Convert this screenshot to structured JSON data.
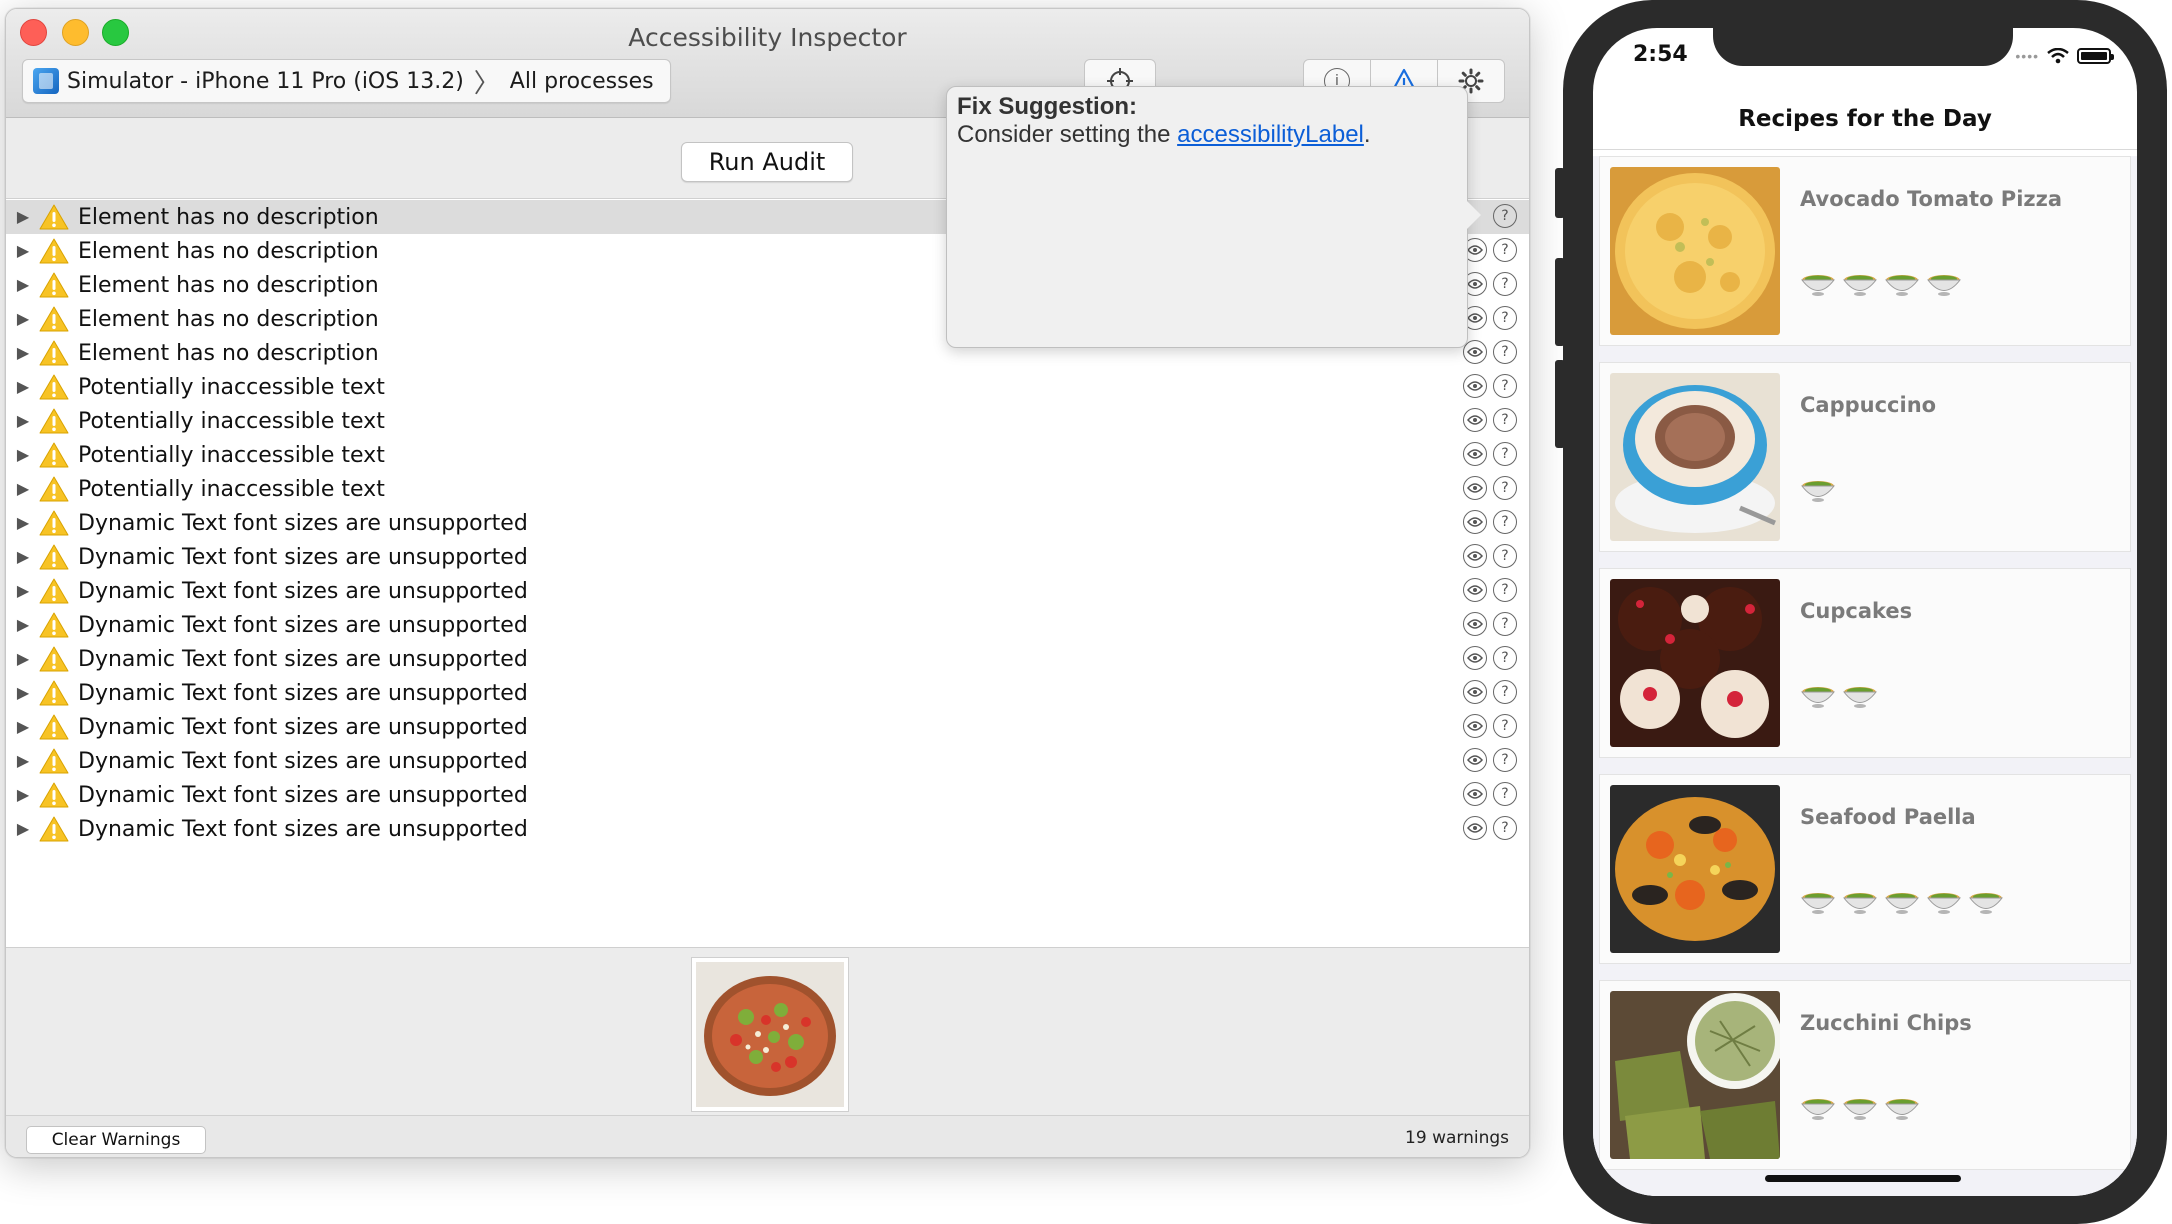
{
  "window": {
    "title": "Accessibility Inspector",
    "target": {
      "device": "Simulator - iPhone 11 Pro (iOS 13.2)",
      "process": "All processes"
    }
  },
  "toolbar": {
    "run_audit_label": "Run Audit"
  },
  "popover": {
    "title": "Fix Suggestion:",
    "body_prefix": "Consider setting the ",
    "link_text": "accessibilityLabel",
    "body_suffix": "."
  },
  "warnings": [
    {
      "text": "Element has no description",
      "selected": true
    },
    {
      "text": "Element has no description"
    },
    {
      "text": "Element has no description"
    },
    {
      "text": "Element has no description"
    },
    {
      "text": "Element has no description"
    },
    {
      "text": "Potentially inaccessible text"
    },
    {
      "text": "Potentially inaccessible text"
    },
    {
      "text": "Potentially inaccessible text"
    },
    {
      "text": "Potentially inaccessible text"
    },
    {
      "text": "Dynamic Text font sizes are unsupported"
    },
    {
      "text": "Dynamic Text font sizes are unsupported"
    },
    {
      "text": "Dynamic Text font sizes are unsupported"
    },
    {
      "text": "Dynamic Text font sizes are unsupported"
    },
    {
      "text": "Dynamic Text font sizes are unsupported"
    },
    {
      "text": "Dynamic Text font sizes are unsupported"
    },
    {
      "text": "Dynamic Text font sizes are unsupported"
    },
    {
      "text": "Dynamic Text font sizes are unsupported"
    },
    {
      "text": "Dynamic Text font sizes are unsupported"
    },
    {
      "text": "Dynamic Text font sizes are unsupported"
    }
  ],
  "footer": {
    "clear_label": "Clear Warnings",
    "count_label": "19 warnings"
  },
  "phone": {
    "time": "2:54",
    "nav_title": "Recipes for the Day",
    "recipes": [
      {
        "name": "Avocado Tomato Pizza",
        "rating": 4
      },
      {
        "name": "Cappuccino",
        "rating": 1
      },
      {
        "name": "Cupcakes",
        "rating": 2
      },
      {
        "name": "Seafood Paella",
        "rating": 5
      },
      {
        "name": "Zucchini Chips",
        "rating": 3
      }
    ]
  },
  "colors": {
    "accent": "#1a6fe0",
    "warning": "#f7c325",
    "link": "#0b5ed7"
  },
  "icons": {
    "warning": "warning-triangle-icon",
    "inspect": "eye-icon",
    "help": "question-mark-icon",
    "rating": "soup-bowl-icon"
  }
}
